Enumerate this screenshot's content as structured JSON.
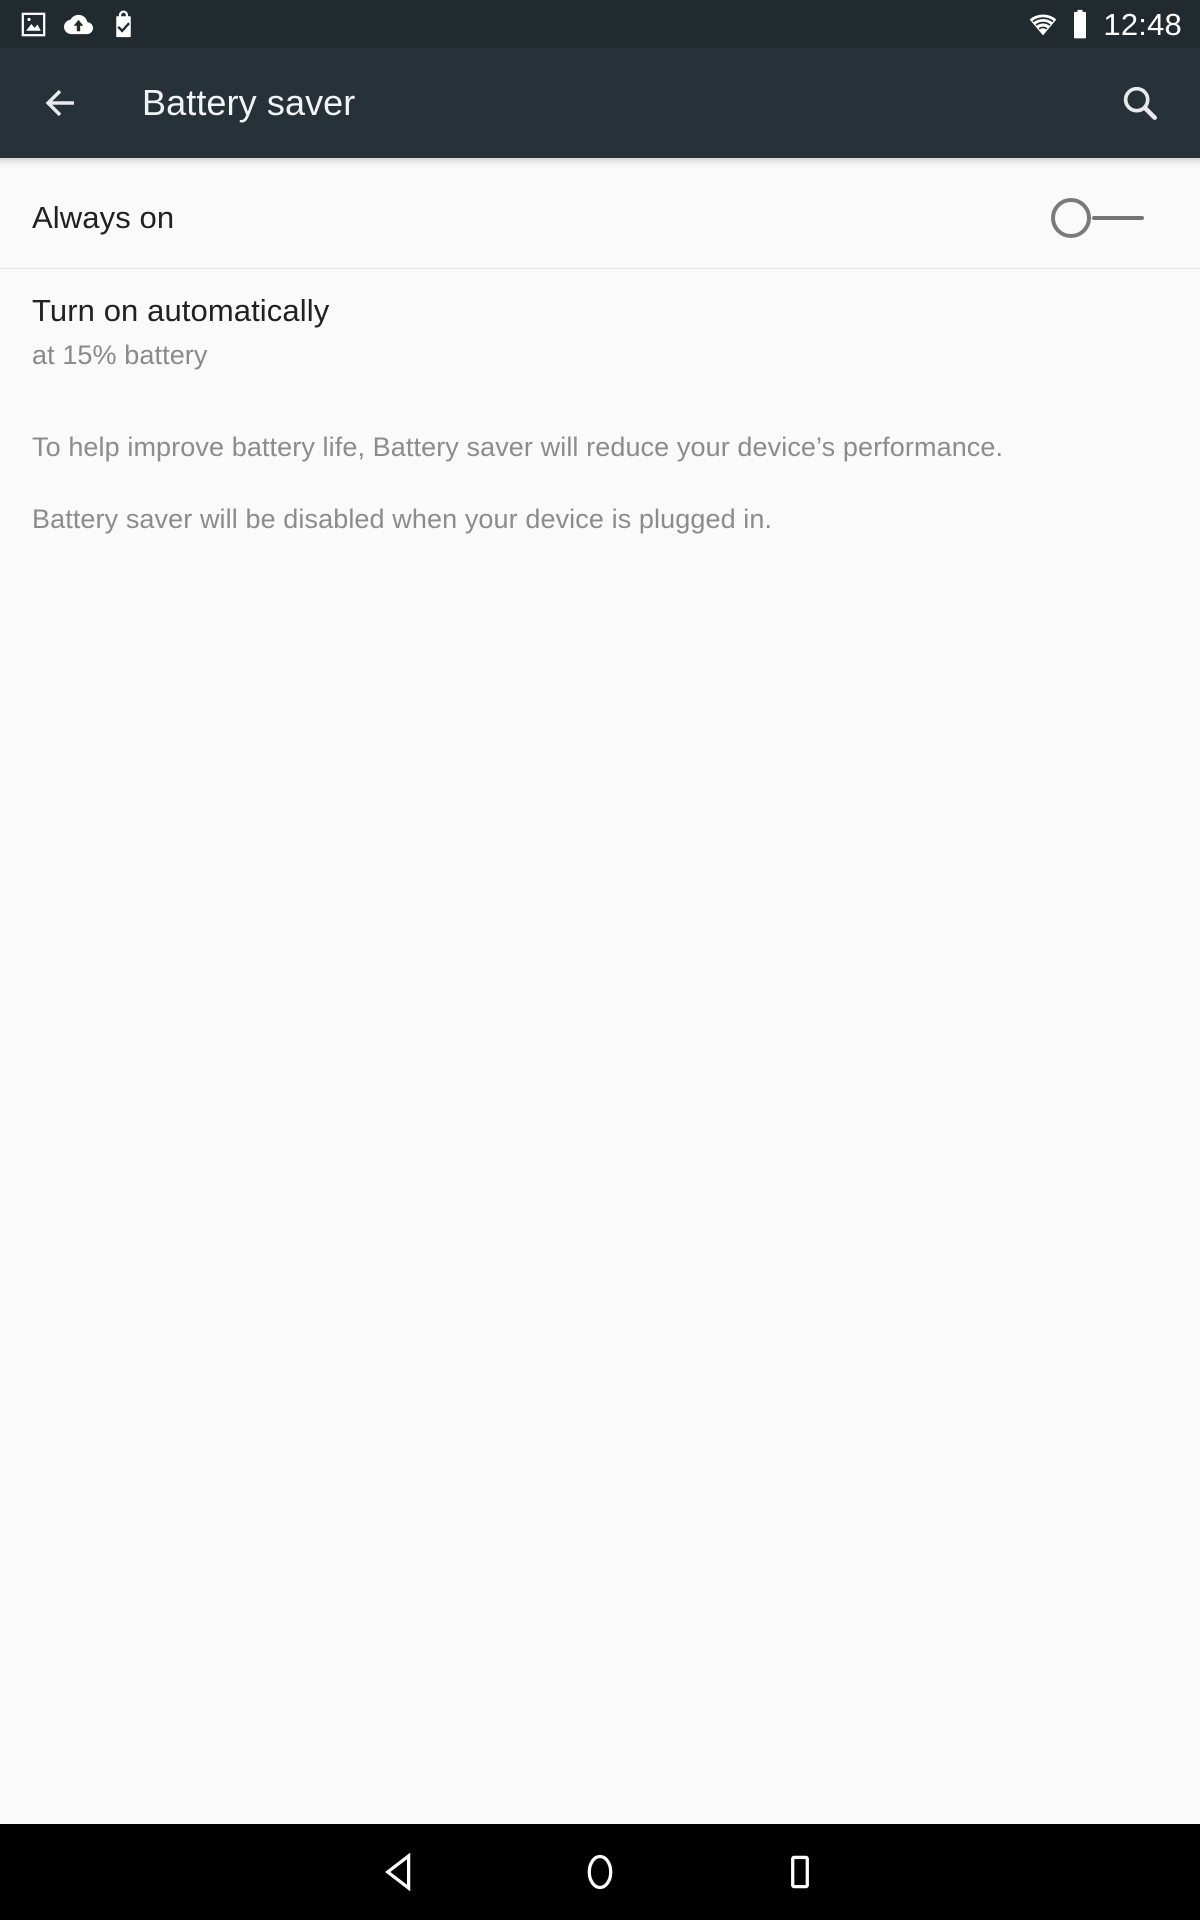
{
  "status_bar": {
    "icons": [
      {
        "name": "photo-image-icon",
        "label": "Screenshot captured"
      },
      {
        "name": "cloud-upload-icon",
        "label": "Backup uploading"
      },
      {
        "name": "shopping-bag-check-icon",
        "label": "Play Store install complete"
      }
    ],
    "wifi": {
      "name": "wifi-icon",
      "label": "Wi-Fi connected"
    },
    "battery": {
      "name": "battery-full-icon",
      "label": "Battery full"
    },
    "clock": "12:48",
    "background_color": "#212a2e",
    "foreground_color": "#ffffff"
  },
  "app_bar": {
    "back_icon": "arrow-back-icon",
    "title": "Battery saver",
    "search_icon": "search-icon",
    "background_color": "#263238",
    "title_color": "#f1f3f4"
  },
  "settings": {
    "always_on": {
      "title": "Always on",
      "switch_state": "off"
    },
    "turn_on_automatically": {
      "title": "Turn on automatically",
      "summary": "at 15% battery",
      "threshold_percent": 15
    }
  },
  "info": {
    "paragraphs": [
      "To help improve battery life, Battery saver will reduce your device’s performance.",
      "Battery saver will be disabled when your device is plugged in."
    ],
    "text_color": "#8c8c8c"
  },
  "nav_bar": {
    "background_color": "#000000",
    "buttons": [
      {
        "name": "nav-back-button",
        "icon": "triangle-left-icon",
        "label": "Back"
      },
      {
        "name": "nav-home-button",
        "icon": "circle-icon",
        "label": "Home"
      },
      {
        "name": "nav-recents-button",
        "icon": "square-icon",
        "label": "Recents"
      }
    ]
  },
  "page": {
    "background_color": "#fafafa",
    "divider_color": "#e4e4e4"
  }
}
